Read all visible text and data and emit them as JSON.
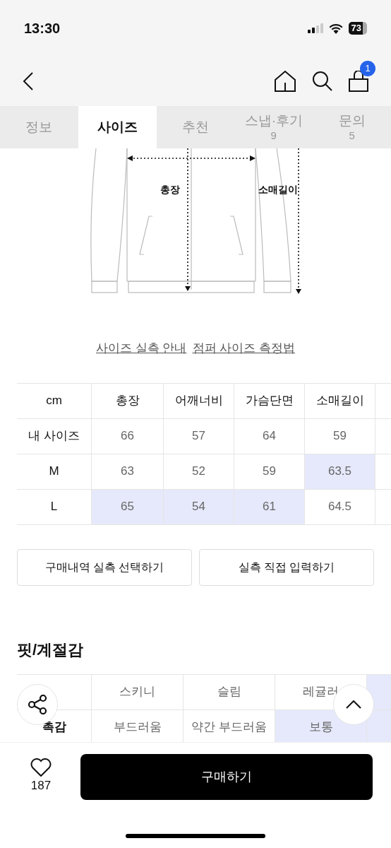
{
  "status_bar": {
    "time": "13:30",
    "battery": "73"
  },
  "header": {
    "cart_count": "1"
  },
  "tabs": [
    {
      "label": "정보",
      "selected": false
    },
    {
      "label": "사이즈",
      "selected": true
    },
    {
      "label": "추천",
      "selected": false
    },
    {
      "label": "스냅·후기",
      "count": "9",
      "selected": false
    },
    {
      "label": "문의",
      "count": "5",
      "selected": false
    }
  ],
  "diagram": {
    "labels": [
      "총장",
      "소매길이"
    ]
  },
  "links": [
    "사이즈 실측 안내",
    "점퍼 사이즈 측정법"
  ],
  "size_table": {
    "columns": [
      "cm",
      "총장",
      "어깨너비",
      "가슴단면",
      "소매길이"
    ],
    "rows": [
      {
        "cells": [
          {
            "text": "내 사이즈",
            "selected": false
          },
          {
            "text": "66",
            "selected": false
          },
          {
            "text": "57",
            "selected": false
          },
          {
            "text": "64",
            "selected": false
          },
          {
            "text": "59",
            "selected": false
          }
        ]
      },
      {
        "cells": [
          {
            "text": "M",
            "selected": false
          },
          {
            "text": "63",
            "selected": false
          },
          {
            "text": "52",
            "selected": false
          },
          {
            "text": "59",
            "selected": false
          },
          {
            "text": "63.5",
            "selected": true
          }
        ]
      },
      {
        "cells": [
          {
            "text": "L",
            "selected": false
          },
          {
            "text": "65",
            "selected": true
          },
          {
            "text": "54",
            "selected": true
          },
          {
            "text": "61",
            "selected": true
          },
          {
            "text": "64.5",
            "selected": false
          }
        ]
      }
    ]
  },
  "actions": [
    "구매내역 실측 선택하기",
    "실측 직접 입력하기"
  ],
  "fit_section": {
    "title": "핏/계절감",
    "rows": [
      {
        "options": [
          {
            "text": "스키니",
            "selected": false
          },
          {
            "text": "슬림",
            "selected": false
          },
          {
            "text": "레귤러",
            "selected": false
          },
          {
            "selected": true
          }
        ]
      },
      {
        "label": "촉감",
        "options": [
          {
            "text": "부드러움",
            "selected": false
          },
          {
            "text": "약간 부드러움",
            "selected": false
          },
          {
            "text": "보통",
            "selected": true
          },
          {
            "selected": true
          }
        ]
      }
    ]
  },
  "bottom_bar": {
    "likes": "187",
    "buy_button": "구매하기"
  }
}
